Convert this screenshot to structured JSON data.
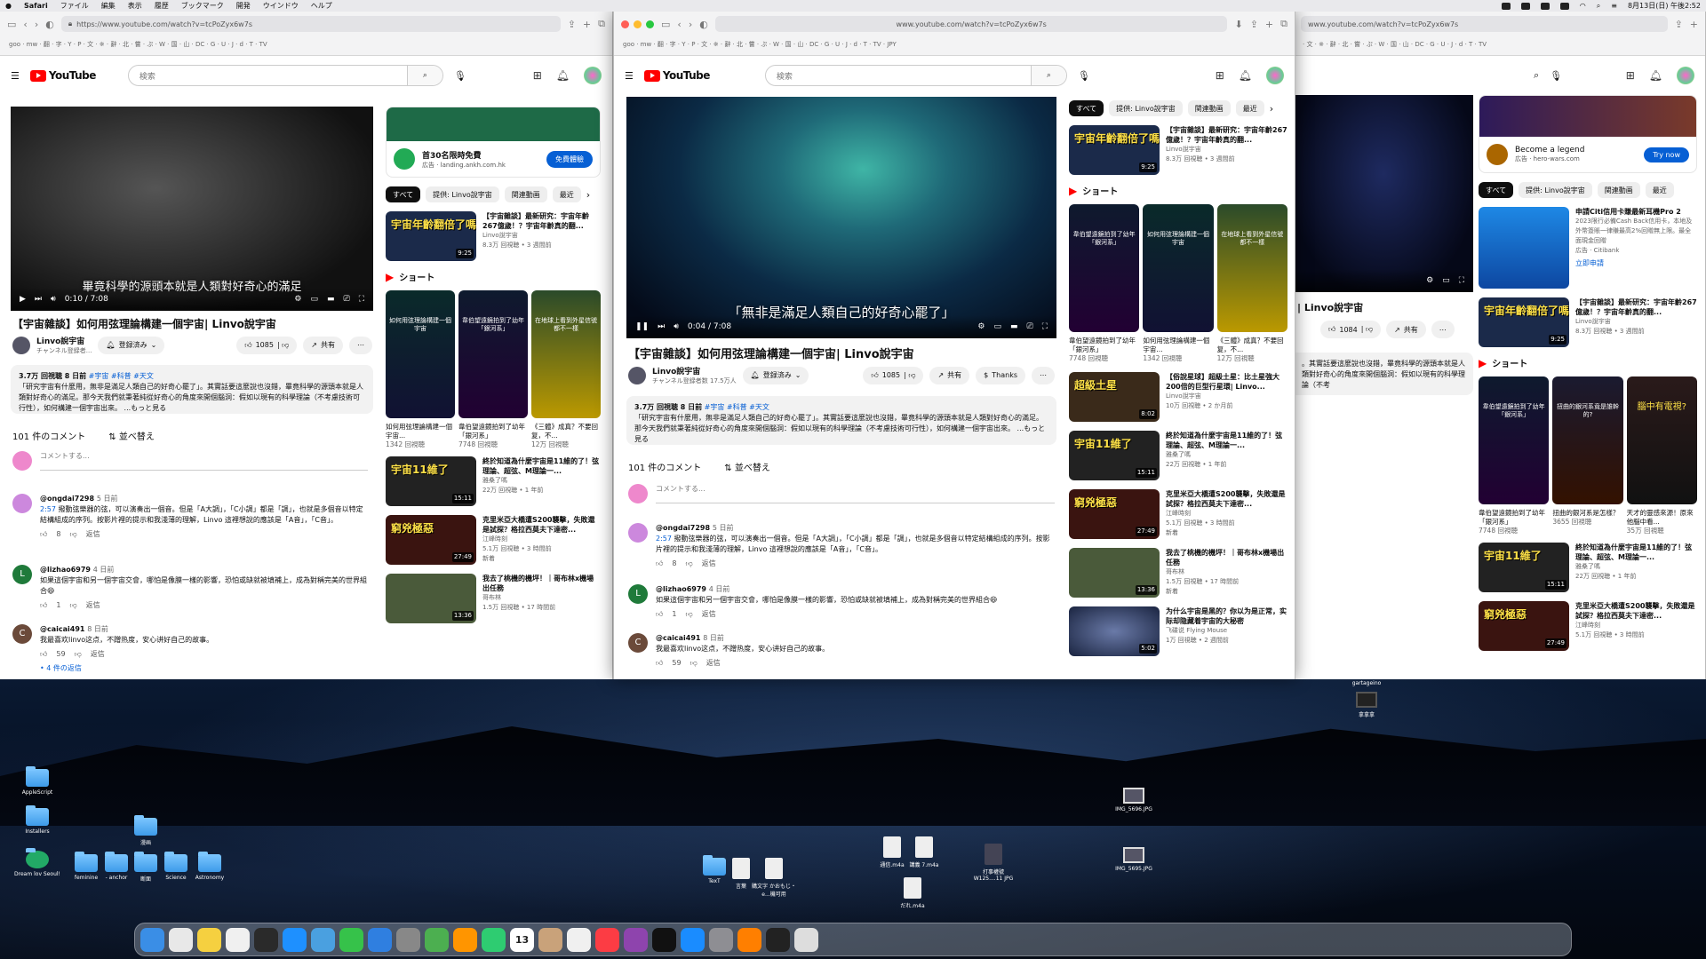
{
  "menubar": {
    "app": "Safari",
    "items": [
      "ファイル",
      "編集",
      "表示",
      "履歴",
      "ブックマーク",
      "開発",
      "ウインドウ",
      "ヘルプ"
    ],
    "clock": "8月13日(日) 午後2:52"
  },
  "url": "https://www.youtube.com/watch?v=tcPoZyx6w7s",
  "url_short": "www.youtube.com/watch?v=tcPoZyx6w7s",
  "search_placeholder": "検索",
  "video": {
    "title": "【宇宙雜談】如何用弦理論構建一個宇宙| Linvo說宇宙",
    "channel": "Linvo說宇宙",
    "subs1": "チャンネル登録者...",
    "subs2": "チャンネル登録者数 17.5万人",
    "subscribe": "登録済み",
    "likes": "1085",
    "likes3": "1084",
    "share": "共有",
    "thanks": "Thanks",
    "subtitle1": "畢竟科學的源頭本就是人類對好奇心的滿足",
    "subtitle2": "「無非是滿足人類自己的好奇心罷了」",
    "time1": "0:10 / 7:08",
    "time2": "0:04 / 7:08",
    "meta": "3.7万 回視聴  8 日前",
    "tags": "#宇宙 #科普 #天文",
    "desc": "「研究宇宙有什麼用，無非是滿足人類自己的好奇心罷了」。其實話要這麼說也沒錯，畢竟科學的源頭本就是人類對好奇心的滿足。那今天我們就秉著純從好奇心的角度來開個腦洞：假如以現有的科學理論（不考慮技術可行性），如何構建一個宇宙出來。 ...もっと見る",
    "desc3": "。其實話要這麼說也沒錯，畢竟科學的源頭本就是人類對好奇心的角度來開個腦洞：假如以現有的科學理論（不考"
  },
  "comments": {
    "count": "101 件のコメント",
    "sort": "並べ替え",
    "placeholder": "コメントする...",
    "reply": "返信",
    "items": [
      {
        "user": "@ongdai7298",
        "time": "5 日前",
        "stamp": "2:57",
        "text": "撥動弦樂器的弦，可以演奏出一個音。但是「A大調」，「C小調」都是「調」，也就是多個音以特定結構組成的序列。按影片裡的提示和我淺薄的理解，Linvo 這裡想說的應該是「A音」，「C音」。",
        "likes": "8",
        "avatar": "#c8d",
        "initial": ""
      },
      {
        "user": "@lizhao6979",
        "time": "4 日前",
        "text": "如果這個宇宙和另一個宇宙交會，哪怕是像膜一樣的影響，恐怕或缺就被填補上，成為對稱完美的世界組合😄",
        "likes": "1",
        "avatar": "#1f7a3a",
        "initial": "L"
      },
      {
        "user": "@caicai491",
        "time": "8 日前",
        "text": "我最喜欢linvo这点，不蹭热度，安心讲好自己的故事。",
        "likes": "59",
        "avatar": "#6b4a3a",
        "initial": "C"
      }
    ],
    "replies": "• 4 件の返信"
  },
  "ad": {
    "title": "首30名限時免費",
    "sub": "広告 · landing.ankh.com.hk",
    "cta": "免費體驗"
  },
  "ad3": {
    "title": "Become a legend",
    "sub": "広告 · hero-wars.com",
    "cta": "Try now"
  },
  "ad3b": {
    "title": "申請Citi信用卡賺最新耳機Pro 2",
    "sub": "2023限行必備Cash Back信用卡，本地及外幣簽賬一律賺最高2%回贈無上限。最全面現金回贈",
    "adv": "広告 · Citibank",
    "cta": "立即申請"
  },
  "chips": [
    "すべて",
    "提供: Linvo說宇宙",
    "関連動画",
    "最近"
  ],
  "shorts_label": "ショート",
  "recs": [
    {
      "title": "【宇宙雜談】最新研究：宇宙年齡267億歲！？宇宙年齡真的翻...",
      "ch": "Linvo說宇宙",
      "meta": "8.3万 回視聴 • 3 週間前",
      "dur": "9:25",
      "thumb": "宇宙年齡翻倍了嗎",
      "bg": "#1b2a4a"
    },
    {
      "title": "【俗說星球】超級土星：比土星強大200倍的巨型行星環| Linvo...",
      "ch": "Linvo說宇宙",
      "meta": "10万 回視聴 • 2 か月前",
      "dur": "8:02",
      "thumb": "超級土星",
      "bg": "#3a2a1a"
    },
    {
      "title": "終於知道為什麼宇宙是11維的了！弦理論、超弦、M理論一...",
      "ch": "雅桑了嗎",
      "meta": "22万 回視聴 • 1 年前",
      "dur": "15:11",
      "thumb": "宇宙11維了",
      "bg": "#222"
    },
    {
      "title": "克里米亞大橋遭S200襲擊，失敗還是試探？格拉西莫夫下達密...",
      "ch": "江峰時刻",
      "meta": "5.1万 回視聴 • 3 時間前",
      "dur": "27:49",
      "thumb": "窮兇極惡",
      "bg": "#3a1410",
      "badge": "新着"
    },
    {
      "title": "我去了桃機的機坪！｜哥布林x機場出任務",
      "ch": "哥布林",
      "meta": "1.5万 回視聴 • 17 時間前",
      "dur": "13:36",
      "thumb": "",
      "bg": "#4a5a3a",
      "badge": "新着"
    },
    {
      "title": "为什么宇宙是黑的？你以为是正常，实际却隐藏着宇宙的大秘密",
      "ch": "飞碟说 Flying Mouse",
      "meta": "1万 回視聴 • 2 週間前",
      "dur": "5:02",
      "thumb": "",
      "bg": "#1a2440"
    }
  ],
  "shorts": [
    {
      "title": "韋伯望遠鏡拍到了幼年「銀河系」",
      "meta": "7748 回視聴",
      "text": "韋伯望遠鏡拍到了幼年「銀河系」",
      "bg": "#0e1a2e"
    },
    {
      "title": "如何用弦理論構建一個宇宙...",
      "meta": "1342 回視聴",
      "text": "如何用弦理論構建一個宇宙",
      "bg": "#0a2a2a"
    },
    {
      "title": "《三體》成真？不要回复，不...",
      "meta": "12万 回視聴",
      "text": "在地球上看到外星信號 都不一樣",
      "bg": "#2a4a2a"
    },
    {
      "title": "扭曲的銀河系是怎樣？",
      "meta": "3655 回視聴",
      "text": "扭曲的銀河系竟是誰幹的?",
      "bg": "#1a1a30"
    },
    {
      "title": "天才的靈感來源！原來他腦中看...",
      "meta": "35万 回視聴",
      "text": "腦中有電視?",
      "bg": "#2a1a1a"
    }
  ],
  "desktop": {
    "left": [
      "AppleScript",
      "Installers",
      "Dream lov Seoul!",
      "feminine",
      "- anchor",
      "断面",
      "Science",
      "Astronomy",
      "漫画"
    ],
    "mid": [
      "TexT",
      "言葉",
      "購文字 かおもじ・e...機可用",
      "通信.m4a",
      "講義 7.m4a",
      "だれ.m4a",
      "打事權號 W125....11 JPG"
    ],
    "right": [
      "IMG_5696.JPG",
      "IMG_5695.JPG",
      "gartageino",
      "拿拿拿"
    ]
  },
  "dock_icons": [
    "finder-icon",
    "launchpad-icon",
    "notes-icon",
    "textedit-icon",
    "dash-icon",
    "safari-icon",
    "preview-icon",
    "messages-icon",
    "mail-icon",
    "scripts-icon",
    "maps-icon",
    "photos-icon",
    "facetime-icon",
    "calendar-icon",
    "contacts-icon",
    "reminders-icon",
    "music-icon",
    "podcasts-icon",
    "tv-icon",
    "appstore-icon",
    "settings-icon",
    "vlc-icon",
    "terminal-icon",
    "trash-icon"
  ],
  "calendar_day": "13"
}
